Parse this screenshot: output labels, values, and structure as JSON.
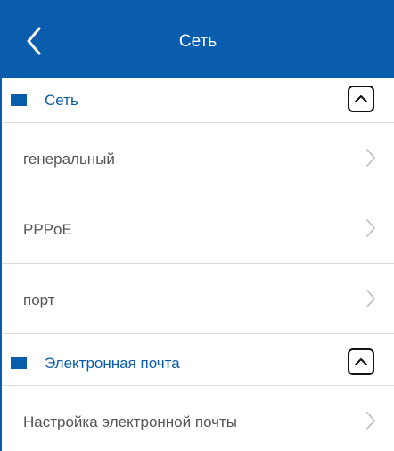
{
  "header": {
    "title": "Сеть",
    "back_icon": "chevron-left-icon"
  },
  "colors": {
    "accent": "#0a5cad",
    "item_text": "#555555",
    "divider": "#dcdcdc"
  },
  "sections": [
    {
      "label": "Сеть",
      "collapse_icon": "chevron-up-icon",
      "items": [
        {
          "label": "генеральный",
          "icon": "chevron-right-icon"
        },
        {
          "label": "PPPoE",
          "icon": "chevron-right-icon"
        },
        {
          "label": "порт",
          "icon": "chevron-right-icon"
        }
      ]
    },
    {
      "label": "Электронная почта",
      "collapse_icon": "chevron-up-icon",
      "items": [
        {
          "label": "Настройка электронной почты",
          "icon": "chevron-right-icon"
        }
      ]
    }
  ]
}
